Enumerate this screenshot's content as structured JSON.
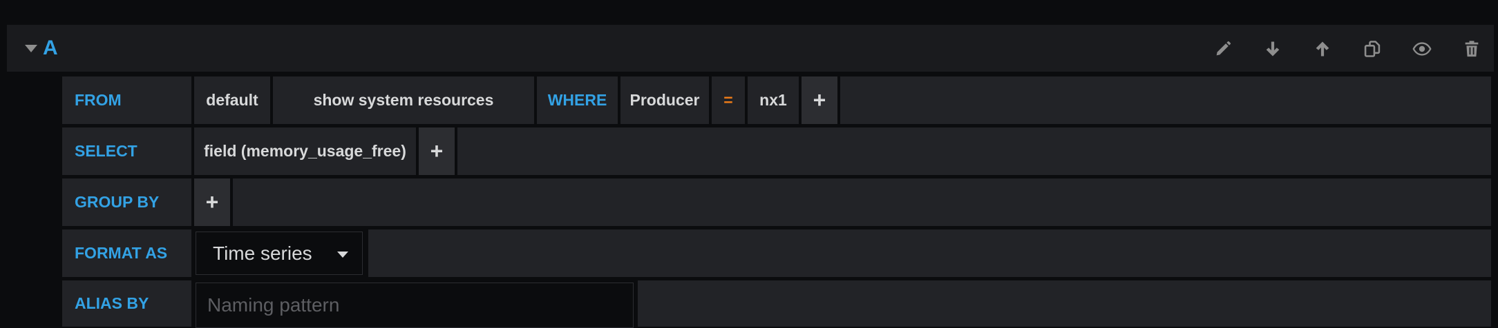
{
  "query": {
    "letter": "A",
    "toolbar": [
      "pencil-icon",
      "arrow-down-icon",
      "arrow-up-icon",
      "copy-icon",
      "eye-icon",
      "trash-icon"
    ]
  },
  "from": {
    "keyword": "FROM",
    "policy": "default",
    "measurement": "show system resources",
    "where_keyword": "WHERE",
    "tag_key": "Producer",
    "operator": "=",
    "tag_value": "nx1",
    "add": "+"
  },
  "select": {
    "keyword": "SELECT",
    "field": "field (memory_usage_free)",
    "add": "+"
  },
  "group_by": {
    "keyword": "GROUP BY",
    "add": "+"
  },
  "format_as": {
    "keyword": "FORMAT AS",
    "value": "Time series"
  },
  "alias_by": {
    "keyword": "ALIAS BY",
    "value": "",
    "placeholder": "Naming pattern"
  },
  "colors": {
    "background": "#0b0c0e",
    "panel": "#222327",
    "keyword": "#33a2e5",
    "operator": "#eb7b18",
    "text": "#d8d9da"
  }
}
